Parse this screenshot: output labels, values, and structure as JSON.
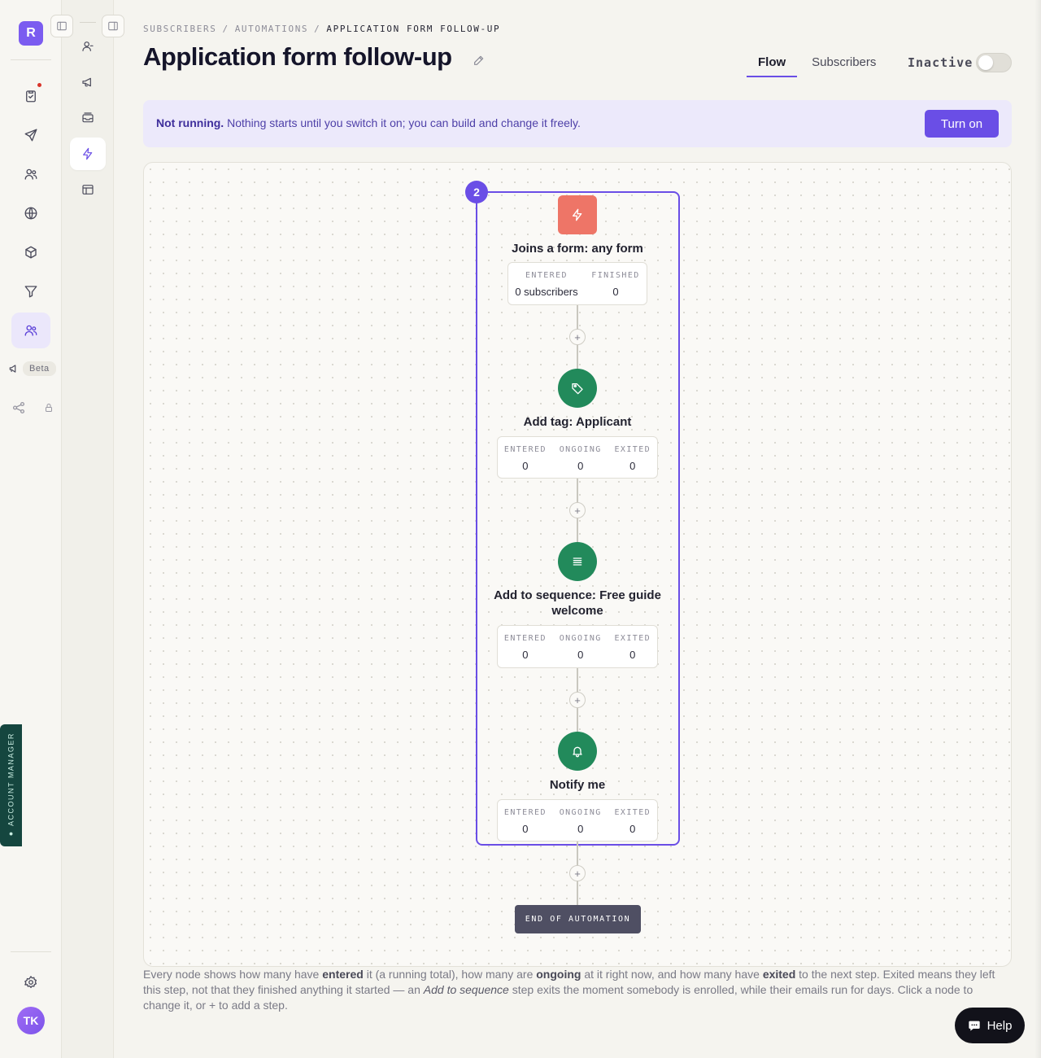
{
  "app": {
    "logo_letter": "R",
    "avatar_initials": "TK",
    "beta_label": "Beta",
    "account_manager_label": "● ACCOUNT MANAGER"
  },
  "rail": {
    "items": [
      {
        "name": "tasks",
        "icon": "clipboard-check-icon",
        "has_notification": true
      },
      {
        "name": "send",
        "icon": "paper-plane-icon"
      },
      {
        "name": "audience",
        "icon": "users-icon"
      },
      {
        "name": "websites",
        "icon": "globe-icon"
      },
      {
        "name": "products",
        "icon": "box-icon"
      },
      {
        "name": "funnels",
        "icon": "filter-icon"
      },
      {
        "name": "subscribers",
        "icon": "users-icon",
        "active": true
      }
    ]
  },
  "subnav": {
    "items": [
      {
        "name": "people",
        "icon": "user-icon"
      },
      {
        "name": "broadcasts",
        "icon": "megaphone-icon"
      },
      {
        "name": "inbox",
        "icon": "inbox-icon"
      },
      {
        "name": "automations",
        "icon": "bolt-icon",
        "active": true
      },
      {
        "name": "layouts",
        "icon": "layout-icon"
      }
    ]
  },
  "breadcrumb": {
    "items": [
      "SUBSCRIBERS",
      "AUTOMATIONS"
    ],
    "separator": "/",
    "current": "APPLICATION FORM FOLLOW-UP"
  },
  "header": {
    "title": "Application form follow-up",
    "tabs": [
      {
        "label": "Flow",
        "active": true
      },
      {
        "label": "Subscribers",
        "active": false
      }
    ],
    "status_label": "Inactive",
    "active": false
  },
  "banner": {
    "strong": "Not running.",
    "text": "Nothing starts until you switch it on; you can build and change it freely.",
    "button_label": "Turn on"
  },
  "flow": {
    "group_badge": "2",
    "plus_label": "+",
    "trigger": {
      "title": "Joins a form: any form",
      "icon": "bolt-icon",
      "stats": [
        {
          "label": "ENTERED",
          "value": "0 subscribers"
        },
        {
          "label": "FINISHED",
          "value": "0"
        }
      ]
    },
    "steps": [
      {
        "title": "Add tag: Applicant",
        "icon": "tag-icon",
        "stats": [
          {
            "label": "ENTERED",
            "value": "0"
          },
          {
            "label": "ONGOING",
            "value": "0"
          },
          {
            "label": "EXITED",
            "value": "0"
          }
        ]
      },
      {
        "title": "Add to sequence: Free guide welcome",
        "icon": "list-icon",
        "stats": [
          {
            "label": "ENTERED",
            "value": "0"
          },
          {
            "label": "ONGOING",
            "value": "0"
          },
          {
            "label": "EXITED",
            "value": "0"
          }
        ]
      },
      {
        "title": "Notify me",
        "icon": "bell-icon",
        "stats": [
          {
            "label": "ENTERED",
            "value": "0"
          },
          {
            "label": "ONGOING",
            "value": "0"
          },
          {
            "label": "EXITED",
            "value": "0"
          }
        ]
      }
    ],
    "end_label": "END OF AUTOMATION"
  },
  "footnote": {
    "p1": "Every node shows how many have ",
    "b1": "entered",
    "p2": " it (a running total), how many are ",
    "b2": "ongoing",
    "p3": " at it right now, and how many have ",
    "b3": "exited",
    "p4": " to the next step. Exited means they left this step, not that they finished anything it started — an ",
    "i1": "Add to sequence",
    "p5": " step exits the moment somebody is enrolled, while their emails run for days. Click a node to change it, or + to add a step."
  },
  "help": {
    "label": "Help"
  },
  "colors": {
    "accent": "#6a4ee6",
    "trigger": "#ee7567",
    "action": "#228a5b",
    "banner_bg": "#ece9fb"
  }
}
